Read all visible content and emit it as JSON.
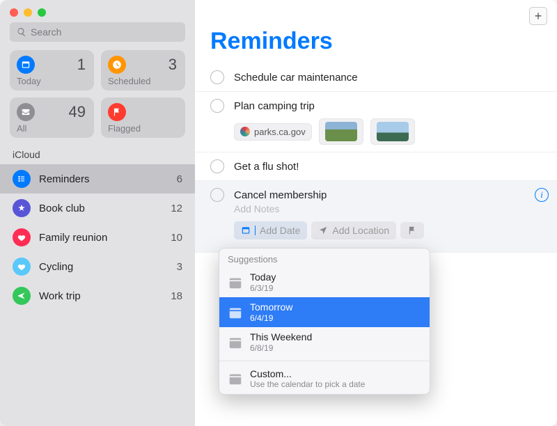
{
  "search": {
    "placeholder": "Search"
  },
  "smart": {
    "today": {
      "label": "Today",
      "count": "1"
    },
    "scheduled": {
      "label": "Scheduled",
      "count": "3"
    },
    "all": {
      "label": "All",
      "count": "49"
    },
    "flagged": {
      "label": "Flagged",
      "count": ""
    }
  },
  "section_label": "iCloud",
  "lists": [
    {
      "name": "Reminders",
      "count": "6",
      "color": "c-blue",
      "selected": true
    },
    {
      "name": "Book club",
      "count": "12",
      "color": "c-purple",
      "selected": false
    },
    {
      "name": "Family reunion",
      "count": "10",
      "color": "c-pink",
      "selected": false
    },
    {
      "name": "Cycling",
      "count": "3",
      "color": "c-teal",
      "selected": false
    },
    {
      "name": "Work trip",
      "count": "18",
      "color": "c-green",
      "selected": false
    }
  ],
  "main": {
    "title": "Reminders",
    "add_glyph": "+",
    "items": [
      {
        "title": "Schedule car maintenance"
      },
      {
        "title": "Plan camping trip",
        "link_text": "parks.ca.gov"
      },
      {
        "title": "Get a flu shot!"
      },
      {
        "title": "Cancel membership",
        "editing": true
      }
    ],
    "editor": {
      "notes_placeholder": "Add Notes",
      "chip_date": "Add Date",
      "chip_location": "Add Location",
      "info_glyph": "i"
    },
    "popover": {
      "header": "Suggestions",
      "items": [
        {
          "title": "Today",
          "sub": "6/3/19",
          "selected": false
        },
        {
          "title": "Tomorrow",
          "sub": "6/4/19",
          "selected": true
        },
        {
          "title": "This Weekend",
          "sub": "6/8/19",
          "selected": false
        }
      ],
      "custom": {
        "title": "Custom...",
        "sub": "Use the calendar to pick a date"
      }
    }
  }
}
